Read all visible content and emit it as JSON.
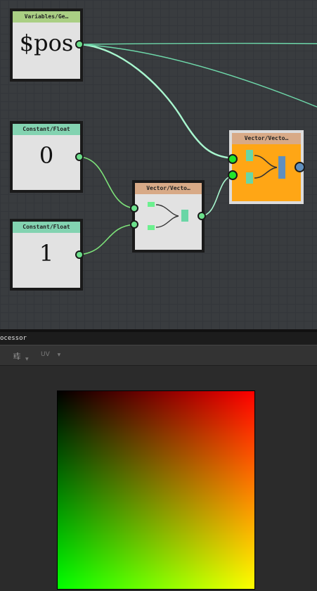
{
  "nodes": {
    "pos": {
      "header": "Variables/Ge…",
      "value": "$pos"
    },
    "const0": {
      "header": "Constant/Float",
      "value": "0"
    },
    "const1": {
      "header": "Constant/Float",
      "value": "1"
    },
    "vec_small": {
      "header": "Vector/Vecto…"
    },
    "vec_orange": {
      "header": "Vector/Vecto…"
    }
  },
  "panel": {
    "tab_title": "ocessor",
    "toolbar": {
      "uv_label": "UV"
    }
  },
  "colors": {
    "wire_pos": "#a8f7cf",
    "wire_float": "#7de37a",
    "orange_body": "#ffa615",
    "port_active": "#24e52a",
    "port_output": "#5f8fbe"
  }
}
